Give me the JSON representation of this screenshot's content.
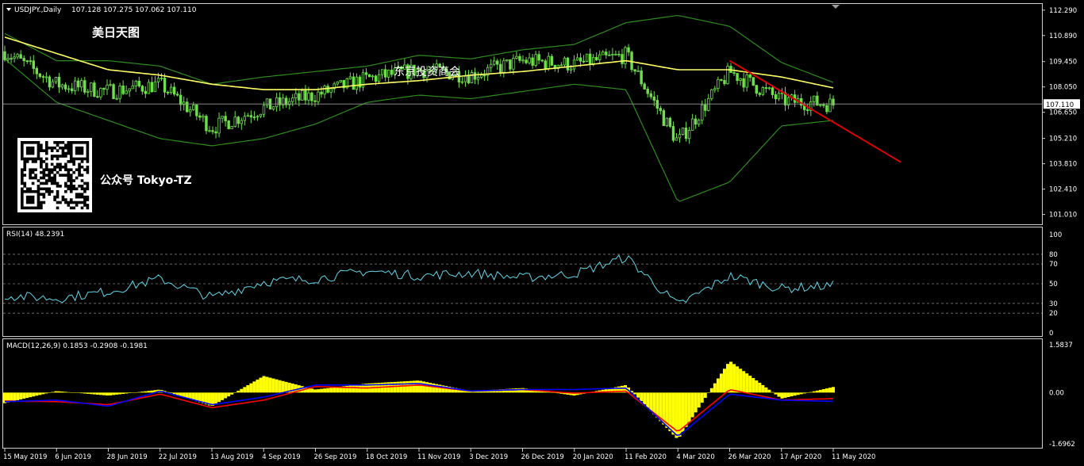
{
  "header": {
    "symbol": "USDJPY.,Daily",
    "ohlc": "107.128 107.275 107.062 107.110"
  },
  "overlays": {
    "brand": "美日天图",
    "watermark": "东京投资商会",
    "wechat": "公众号 Tokyo-TZ"
  },
  "rsi_label": "RSI(14) 48.2391",
  "macd_label": "MACD(12,26,9) 0.1853 -0.2908 -0.1981",
  "current_price_label": "107.110",
  "colors": {
    "background": "#000000",
    "candle": "#6ee04a",
    "ma": "#ffff66",
    "bollinger": "#2e8b1e",
    "trendline": "#e00000",
    "rsi": "#5fd7e8",
    "macd_hist": "#ffff00",
    "macd_line": "#0000ff",
    "signal_line": "#ff0000",
    "axis_text": "#ffffff"
  },
  "chart_data": [
    {
      "type": "line",
      "title": "USDJPY.,Daily",
      "subtype": "candlestick with bollinger bands and moving average",
      "x": [
        "15 May 2019",
        "6 Jun 2019",
        "28 Jun 2019",
        "22 Jul 2019",
        "13 Aug 2019",
        "4 Sep 2019",
        "26 Sep 2019",
        "18 Oct 2019",
        "11 Nov 2019",
        "3 Dec 2019",
        "26 Dec 2019",
        "20 Jan 2020",
        "11 Feb 2020",
        "4 Mar 2020",
        "26 Mar 2020",
        "17 Apr 2020",
        "11 May 2020"
      ],
      "series": [
        {
          "name": "close",
          "values": [
            110.0,
            108.2,
            107.8,
            108.2,
            105.8,
            106.9,
            107.6,
            108.5,
            109.0,
            108.7,
            109.5,
            109.3,
            109.8,
            105.0,
            108.9,
            107.3,
            107.1
          ]
        },
        {
          "name": "ma",
          "values": [
            110.8,
            109.9,
            109.0,
            108.7,
            108.2,
            107.9,
            107.9,
            108.2,
            108.4,
            108.7,
            108.9,
            109.2,
            109.5,
            109.0,
            109.0,
            108.6,
            108.0
          ]
        },
        {
          "name": "bollinger_upper",
          "values": [
            111.0,
            109.5,
            109.5,
            109.2,
            108.2,
            108.6,
            108.9,
            109.2,
            109.8,
            109.6,
            110.1,
            110.4,
            111.6,
            112.0,
            111.4,
            109.4,
            108.3
          ]
        },
        {
          "name": "bollinger_lower",
          "values": [
            109.6,
            107.2,
            106.2,
            105.2,
            104.8,
            105.2,
            106.0,
            107.2,
            107.6,
            107.4,
            107.8,
            108.2,
            107.9,
            101.7,
            102.8,
            105.9,
            106.2
          ]
        }
      ],
      "trendline": {
        "from": [
          "26 Mar 2020",
          109.5
        ],
        "to": [
          "1 Jun 2020",
          103.9
        ]
      },
      "current_price": 107.11,
      "y_ticks": [
        "112.290",
        "110.890",
        "109.450",
        "108.050",
        "106.650",
        "105.210",
        "103.810",
        "102.410",
        "101.010"
      ],
      "ylim": [
        100.6,
        112.5
      ]
    },
    {
      "type": "line",
      "title": "RSI(14) 48.2391",
      "x": [
        "15 May 2019",
        "6 Jun 2019",
        "28 Jun 2019",
        "22 Jul 2019",
        "13 Aug 2019",
        "4 Sep 2019",
        "26 Sep 2019",
        "18 Oct 2019",
        "11 Nov 2019",
        "3 Dec 2019",
        "26 Dec 2019",
        "20 Jan 2020",
        "11 Feb 2020",
        "4 Mar 2020",
        "26 Mar 2020",
        "17 Apr 2020",
        "11 May 2020"
      ],
      "series": [
        {
          "name": "RSI",
          "values": [
            38,
            35,
            42,
            55,
            36,
            52,
            55,
            63,
            58,
            61,
            56,
            60,
            77,
            28,
            58,
            45,
            48.2391
          ]
        }
      ],
      "levels": [
        20,
        30,
        50,
        70,
        80
      ],
      "y_ticks": [
        "100",
        "80",
        "70",
        "50",
        "30",
        "20",
        "0"
      ],
      "ylim": [
        0,
        100
      ]
    },
    {
      "type": "bar",
      "title": "MACD(12,26,9) 0.1853 -0.2908 -0.1981",
      "x": [
        "15 May 2019",
        "6 Jun 2019",
        "28 Jun 2019",
        "22 Jul 2019",
        "13 Aug 2019",
        "4 Sep 2019",
        "26 Sep 2019",
        "18 Oct 2019",
        "11 Nov 2019",
        "3 Dec 2019",
        "26 Dec 2019",
        "20 Jan 2020",
        "11 Feb 2020",
        "4 Mar 2020",
        "26 Mar 2020",
        "17 Apr 2020",
        "11 May 2020"
      ],
      "series": [
        {
          "name": "histogram",
          "values": [
            -0.35,
            0.05,
            -0.1,
            0.1,
            -0.45,
            0.55,
            0.1,
            0.3,
            0.4,
            0.05,
            0.15,
            -0.1,
            0.25,
            -1.55,
            1.05,
            -0.2,
            0.1853
          ]
        },
        {
          "name": "macd",
          "values": [
            -0.3,
            -0.25,
            -0.45,
            0.05,
            -0.4,
            -0.15,
            0.25,
            0.25,
            0.3,
            0.05,
            0.1,
            0.1,
            0.15,
            -1.45,
            -0.05,
            -0.25,
            -0.2908
          ]
        },
        {
          "name": "signal",
          "values": [
            -0.28,
            -0.3,
            -0.4,
            -0.05,
            -0.5,
            -0.25,
            0.2,
            0.15,
            0.25,
            0.05,
            0.1,
            -0.02,
            0.05,
            -1.3,
            0.1,
            -0.25,
            -0.1981
          ]
        }
      ],
      "y_ticks": [
        "1.5837",
        "0.00",
        "-1.6962"
      ],
      "ylim": [
        -1.6962,
        1.5837
      ]
    }
  ],
  "x_axis_labels": [
    "15 May 2019",
    "6 Jun 2019",
    "28 Jun 2019",
    "22 Jul 2019",
    "13 Aug 2019",
    "4 Sep 2019",
    "26 Sep 2019",
    "18 Oct 2019",
    "11 Nov 2019",
    "3 Dec 2019",
    "26 Dec 2019",
    "20 Jan 2020",
    "11 Feb 2020",
    "4 Mar 2020",
    "26 Mar 2020",
    "17 Apr 2020",
    "11 May 2020"
  ]
}
